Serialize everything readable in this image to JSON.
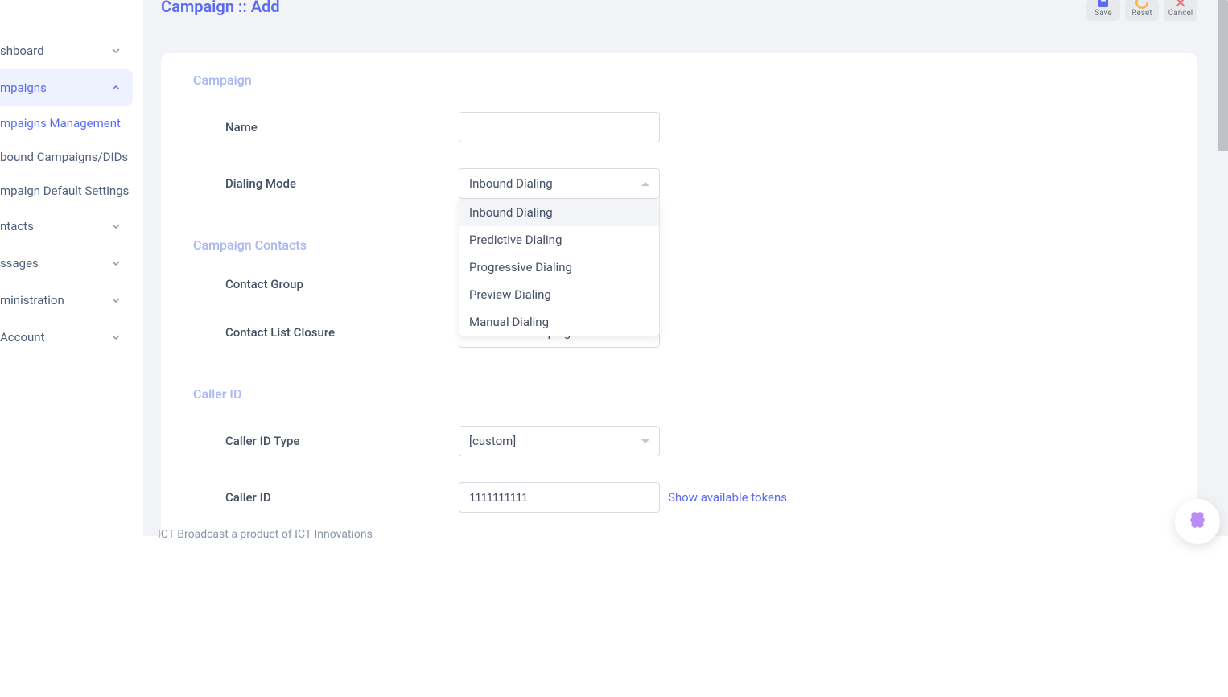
{
  "header": {
    "title": "Campaign :: Add",
    "buttons": {
      "save": "Save",
      "reset": "Reset",
      "cancel": "Cancel"
    }
  },
  "sidebar": {
    "dashboard": "shboard",
    "campaigns": "mpaigns",
    "campaigns_mgmt": "mpaigns Management",
    "inbound": "bound Campaigns/DIDs",
    "defaults": "mpaign Default Settings",
    "contacts": "ntacts",
    "messages": "ssages",
    "administration": "ministration",
    "account": " Account"
  },
  "sections": {
    "campaign": "Campaign",
    "contacts": "Campaign Contacts",
    "callerid": "Caller ID"
  },
  "fields": {
    "name": {
      "label": "Name",
      "value": ""
    },
    "dialing_mode": {
      "label": "Dialing Mode",
      "selected": "Inbound Dialing",
      "options": [
        "Inbound Dialing",
        "Predictive Dialing",
        "Progressive Dialing",
        "Preview Dialing",
        "Manual Dialing"
      ]
    },
    "contact_group": {
      "label": "Contact Group"
    },
    "contact_list_closure": {
      "label": "Contact List Closure",
      "selected": "Conclude Campaign"
    },
    "callerid_type": {
      "label": "Caller ID Type",
      "selected": "[custom]"
    },
    "callerid": {
      "label": "Caller ID",
      "value": "1111111111",
      "tokens_link": "Show available tokens"
    }
  },
  "footer": "ICT Broadcast a product of ICT Innovations"
}
